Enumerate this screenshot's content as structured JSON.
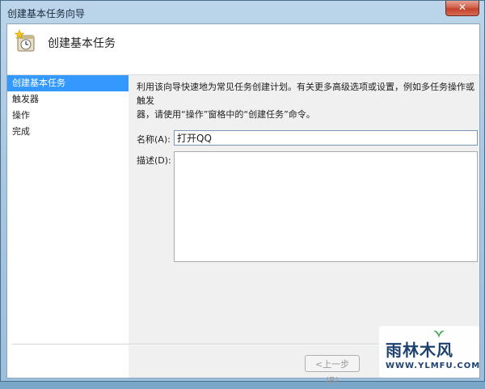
{
  "window": {
    "title": "创建基本任务向导",
    "close_glyph": "✕"
  },
  "header": {
    "title": "创建基本任务",
    "icon": "task-scheduler-clock-icon"
  },
  "sidebar": {
    "items": [
      {
        "label": "创建基本任务",
        "active": true
      },
      {
        "label": "触发器",
        "active": false
      },
      {
        "label": "操作",
        "active": false
      },
      {
        "label": "完成",
        "active": false
      }
    ]
  },
  "main": {
    "description_line1": "利用该向导快速地为常见任务创建计划。有关更多高级选项或设置，例如多任务操作或触发",
    "description_line2": "器，请使用“操作”窗格中的“创建任务”命令。",
    "name_label": "名称(A):",
    "name_value": "打开QQ",
    "desc_label": "描述(D):",
    "desc_value": ""
  },
  "footer": {
    "back_label": "<上一步(B)"
  },
  "watermark": {
    "brand": "雨林木风",
    "url": "WWW.YLMFU.COM"
  },
  "colors": {
    "selection": "#3399ff",
    "title_gradient": "#a9c8e2",
    "close_button": "#c2412b"
  }
}
